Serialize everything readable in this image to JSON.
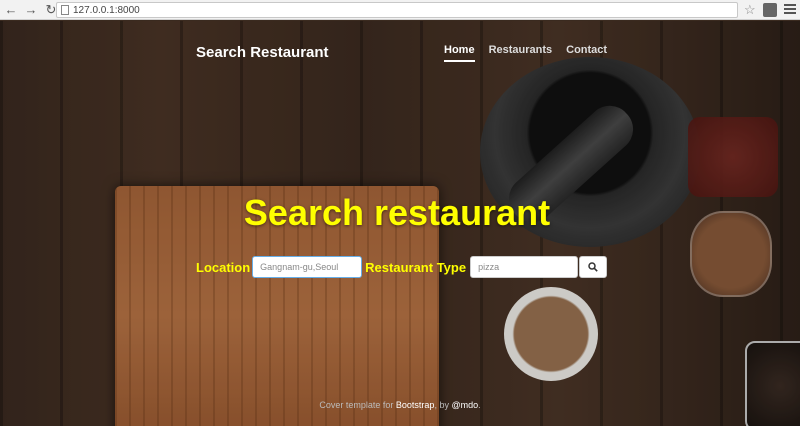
{
  "browser": {
    "url": "127.0.0.1:8000",
    "back_icon": "arrow-left",
    "forward_icon": "arrow-right",
    "reload_icon": "reload",
    "bookmark_icon": "star"
  },
  "masthead": {
    "brand": "Search Restaurant",
    "nav": [
      {
        "label": "Home",
        "active": true
      },
      {
        "label": "Restaurants",
        "active": false
      },
      {
        "label": "Contact",
        "active": false
      }
    ]
  },
  "hero": {
    "title": "Search restaurant"
  },
  "search": {
    "location_label": "Location",
    "location_placeholder": "Gangnam-gu,Seoul",
    "type_label": "Restaurant Type",
    "type_placeholder": "pizza",
    "submit_icon": "search-icon"
  },
  "footer": {
    "prefix": "Cover template for ",
    "link1": "Bootstrap",
    "middle": ", by ",
    "link2": "@mdo",
    "suffix": "."
  },
  "colors": {
    "accent": "#ffff00",
    "input_focus": "#66afe9"
  }
}
